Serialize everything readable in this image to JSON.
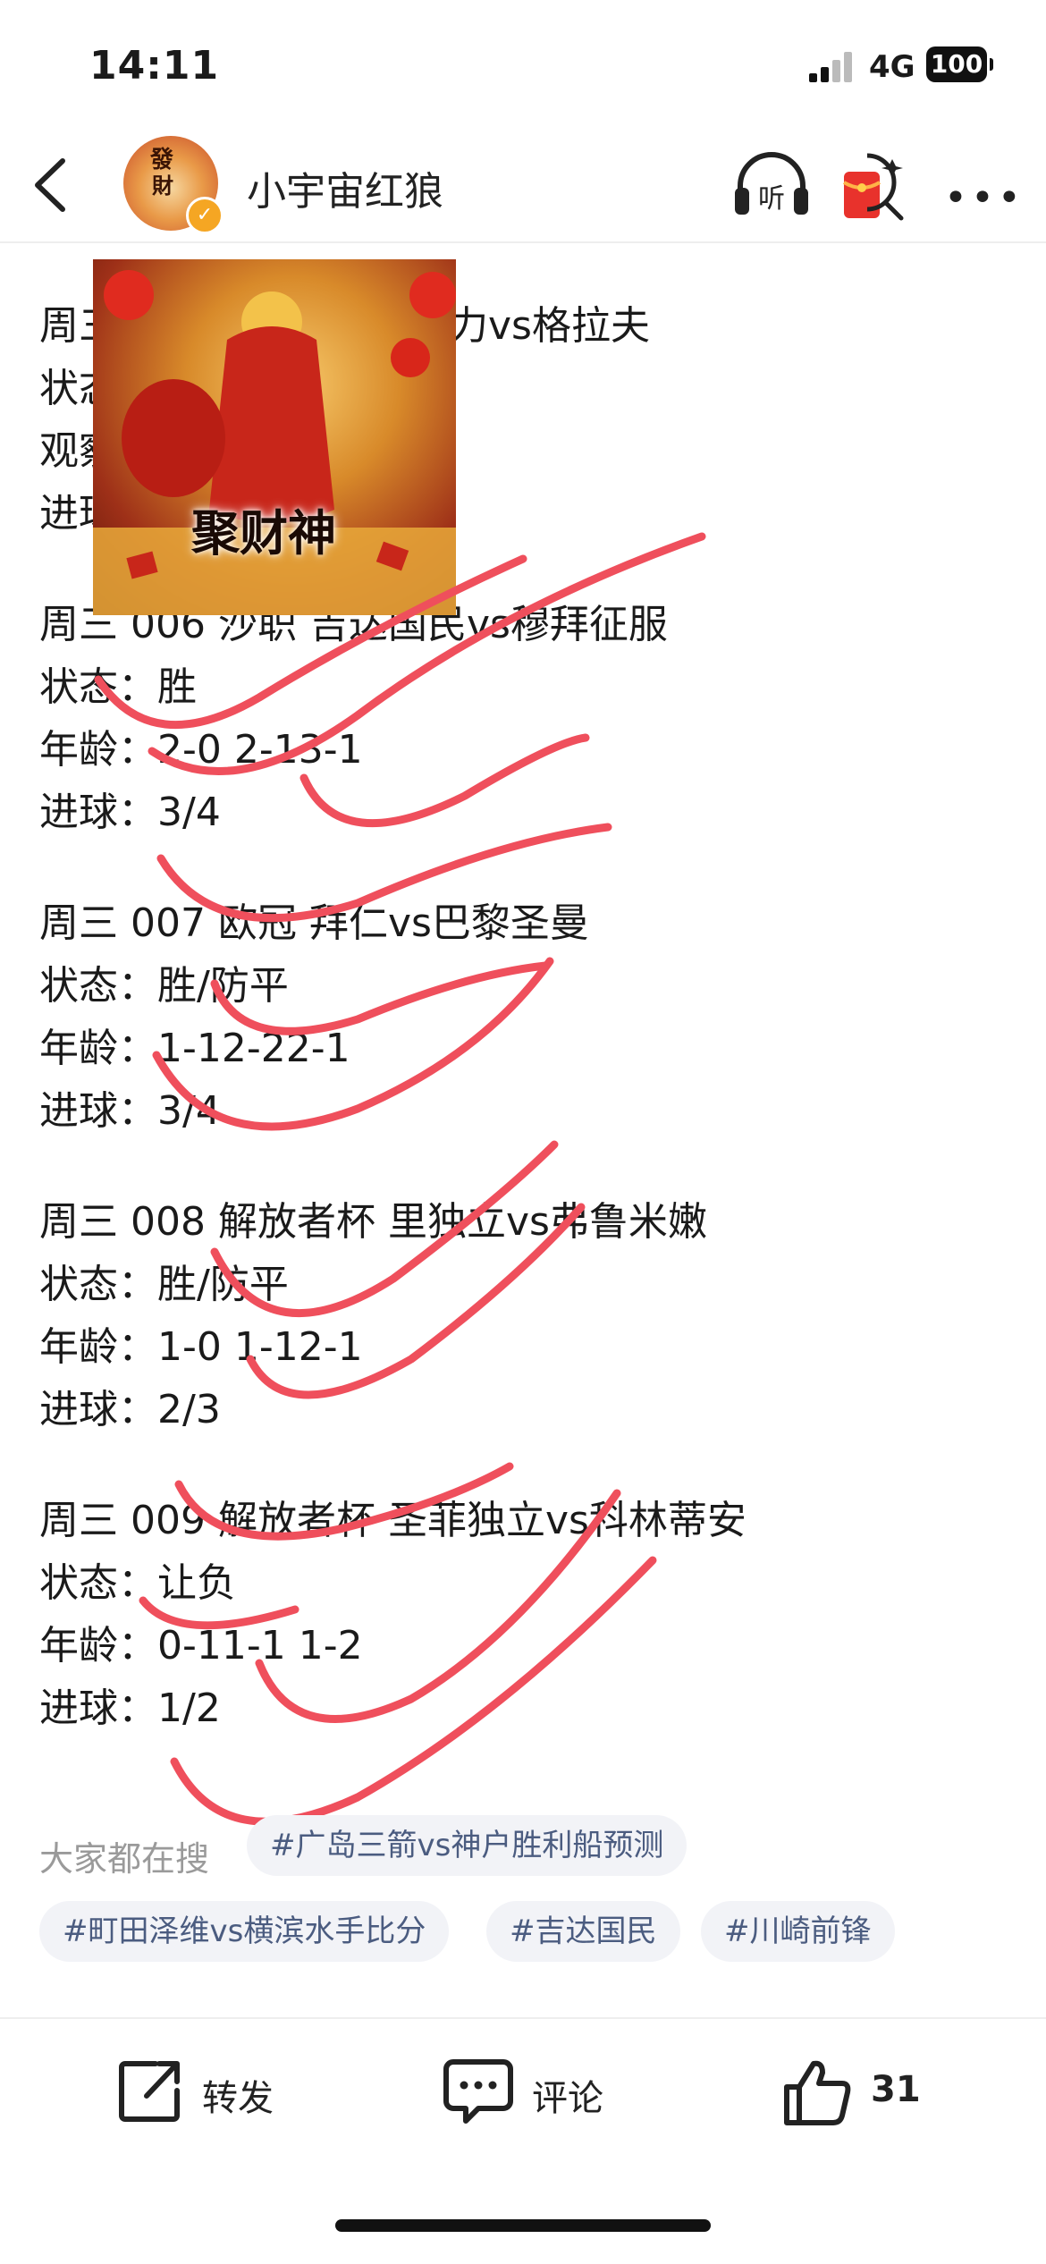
{
  "status_bar": {
    "time": "14:11",
    "network": "4G",
    "battery": "100"
  },
  "header": {
    "username": "小宇宙红狼",
    "listen_label": "听",
    "avatar_text_1": "發",
    "avatar_text_2": "財"
  },
  "overlay_image": {
    "caption": "聚财神"
  },
  "matches": [
    {
      "title": "周三 005 ... 勒vs格拉夫",
      "title_visible": "周三",
      "title_tail": "力vs格拉夫",
      "l1": "状态",
      "l2": "观察",
      "l3": "进球"
    },
    {
      "title": "周三 006 沙职 吉达国民vs穆拜征服",
      "status": "状态：胜",
      "age": "年龄：2-0 2-13-1",
      "goals": "进球：3/4"
    },
    {
      "title": "周三 007 欧冠 拜仁vs巴黎圣曼",
      "status": "状态：胜/防平",
      "age": "年龄：1-12-22-1",
      "goals": "进球：3/4"
    },
    {
      "title": "周三 008 解放者杯 里独立vs弗鲁米嫩",
      "status": "状态：胜/防平",
      "age": "年龄：1-0 1-12-1",
      "goals": "进球：2/3"
    },
    {
      "title": "周三 009 解放者杯 圣菲独立vs科林蒂安",
      "status": "状态：让负",
      "age": "年龄：0-11-1 1-2",
      "goals": "进球：1/2"
    }
  ],
  "search": {
    "label": "大家都在搜",
    "tags": [
      "#广岛三箭vs神户胜利船预测",
      "#町田泽维vs横滨水手比分",
      "#吉达国民",
      "#川崎前锋"
    ]
  },
  "actions": {
    "repost": "转发",
    "comment": "评论",
    "like_count": "31"
  },
  "colors": {
    "scribble": "#ef4f5c",
    "tag_bg": "#f2f3f7",
    "tag_text": "#4b5c80",
    "verify": "#f5a623"
  }
}
